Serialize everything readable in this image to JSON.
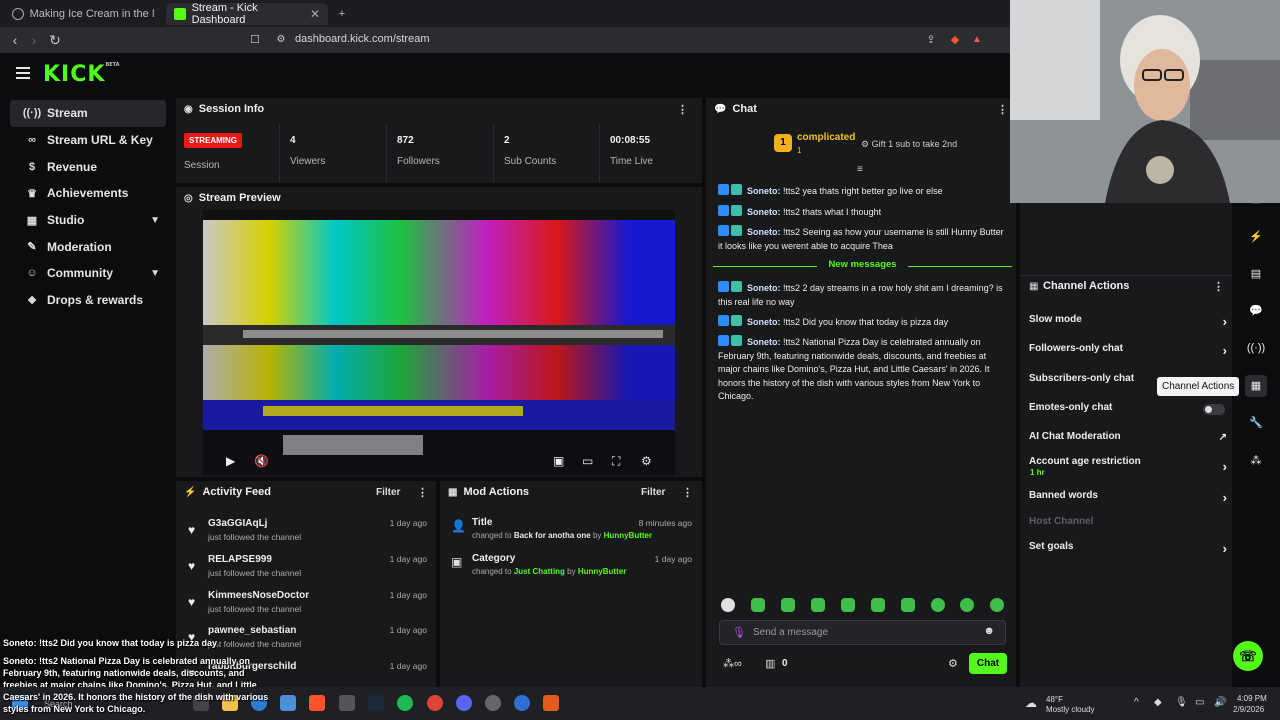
{
  "browser": {
    "tabs": [
      {
        "title": "Making Ice Cream in the NINJA CREA"
      },
      {
        "title": "Stream - Kick Dashboard"
      }
    ],
    "url": "dashboard.kick.com/stream"
  },
  "app": {
    "logo": "KICK",
    "logo_badge": "BETA"
  },
  "sidebar": {
    "items": [
      {
        "label": "Stream",
        "icon": "broadcast-icon"
      },
      {
        "label": "Stream URL & Key",
        "icon": "link-icon"
      },
      {
        "label": "Revenue",
        "icon": "dollar-icon"
      },
      {
        "label": "Achievements",
        "icon": "trophy-icon"
      },
      {
        "label": "Studio",
        "icon": "grid-icon"
      },
      {
        "label": "Moderation",
        "icon": "wrench-icon"
      },
      {
        "label": "Community",
        "icon": "people-icon"
      },
      {
        "label": "Drops & rewards",
        "icon": "gift-icon"
      }
    ]
  },
  "session": {
    "title": "Session Info",
    "badge": "STREAMING",
    "session_label": "Session",
    "stats": [
      {
        "value": "4",
        "label": "Viewers"
      },
      {
        "value": "872",
        "label": "Followers"
      },
      {
        "value": "2",
        "label": "Sub Counts"
      },
      {
        "value": "00:08:55",
        "label": "Time Live"
      }
    ]
  },
  "preview": {
    "title": "Stream Preview"
  },
  "activity": {
    "title": "Activity Feed",
    "filter": "Filter",
    "rows": [
      {
        "name": "G3aGGIAqLj",
        "sub": "just followed the channel",
        "when": "1 day ago"
      },
      {
        "name": "RELAPSE999",
        "sub": "just followed the channel",
        "when": "1 day ago"
      },
      {
        "name": "KimmeesNoseDoctor",
        "sub": "just followed the channel",
        "when": "1 day ago"
      },
      {
        "name": "pawnee_sebastian",
        "sub": "just followed the channel",
        "when": "1 day ago"
      },
      {
        "name": "rabbitburgerschild",
        "sub": "",
        "when": "1 day ago"
      }
    ]
  },
  "mod": {
    "title": "Mod Actions",
    "filter": "Filter",
    "rows": [
      {
        "title": "Title",
        "prefix": "changed to",
        "value": "Back for anotha one",
        "by": "by",
        "user": "HunnyButter",
        "when": "8 minutes ago"
      },
      {
        "title": "Category",
        "prefix": "changed to",
        "value": "Just Chatting",
        "by": "by",
        "user": "HunnyButter",
        "when": "1 day ago"
      }
    ]
  },
  "chat": {
    "title": "Chat",
    "pinned_user": "complicated",
    "pinned_rank": "1",
    "pinned_count": "1",
    "gift_text": "Gift 1 sub to take 2nd",
    "messages": [
      {
        "user": "Soneto:",
        "text": "!tts2 yea thats right better go live or else"
      },
      {
        "user": "Soneto:",
        "text": "!tts2 thats what I thought"
      },
      {
        "user": "Soneto:",
        "text": "!tts2 Seeing as how your username is still Hunny Butter it looks like you werent able to acquire Thea"
      }
    ],
    "new_messages_label": "New messages",
    "new_messages": [
      {
        "user": "Soneto:",
        "text": "!tts2 2 day streams in a row holy shit am I dreaming? is this real life no way"
      },
      {
        "user": "Soneto:",
        "text": "!tts2 Did you know that today is pizza day"
      },
      {
        "user": "Soneto:",
        "text": "!tts2 National Pizza Day is celebrated annually on February 9th, featuring nationwide deals, discounts, and freebies at major chains like Domino's, Pizza Hut, and Little Caesars' in 2026. It honors the history of the dish with various styles from New York to Chicago."
      }
    ],
    "input_placeholder": "Send a message",
    "points": "0",
    "send_label": "Chat"
  },
  "channel_actions": {
    "title": "Channel Actions",
    "tooltip": "Channel Actions",
    "rows": [
      {
        "label": "Slow mode",
        "kind": "arrow"
      },
      {
        "label": "Followers-only chat",
        "kind": "arrow"
      },
      {
        "label": "Subscribers-only chat",
        "kind": "toggle"
      },
      {
        "label": "Emotes-only chat",
        "kind": "toggle"
      },
      {
        "label": "AI Chat Moderation",
        "kind": "external"
      },
      {
        "label": "Account age restriction",
        "sub": "1 hr",
        "kind": "arrow"
      },
      {
        "label": "Banned words",
        "kind": "arrow"
      },
      {
        "label": "Host Channel",
        "kind": "disabled"
      },
      {
        "label": "Set goals",
        "kind": "arrow"
      }
    ]
  },
  "overlay": {
    "line1": "Soneto: !tts2 Did you know that today is pizza day",
    "line2": "Soneto: !tts2 National Pizza Day is celebrated annually on",
    "line3": "February 9th, featuring nationwide deals, discounts, and",
    "line4": "freebies at major chains like Domino's, Pizza Hut, and Little",
    "line5": "Caesars' in 2026. It honors the history of the dish with various",
    "line6": "styles from New York to Chicago."
  },
  "taskbar": {
    "search": "Search",
    "weather_temp": "48°F",
    "weather_desc": "Mostly cloudy",
    "time": "4:09 PM",
    "date": "2/9/2026"
  },
  "colors": {
    "accent": "#53fc18",
    "live": "#e91916",
    "panel": "#18191b",
    "bg": "#0b0c0d"
  }
}
